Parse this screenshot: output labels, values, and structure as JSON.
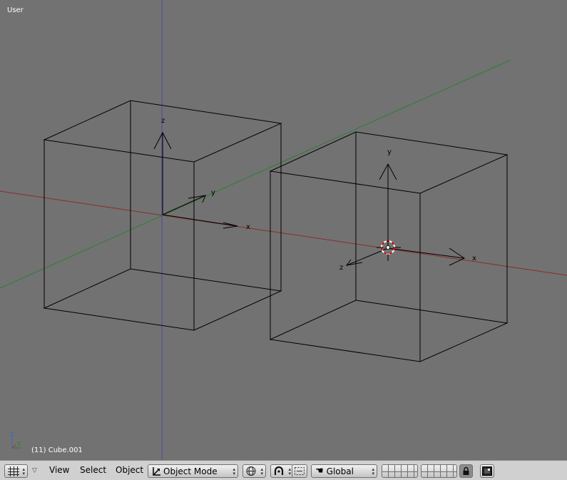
{
  "viewport": {
    "view_label": "User",
    "object_info": "(11) Cube.001",
    "cube_left": {
      "axis_labels": {
        "z": "z",
        "y": "y",
        "x": "x"
      }
    },
    "cube_right": {
      "axis_labels": {
        "y": "y",
        "x": "x",
        "z": "z"
      }
    },
    "mini_axes": {
      "z": "Z",
      "y": "Y"
    },
    "colors": {
      "background": "#727272",
      "x_axis": "#8b2b2b",
      "y_axis": "#2e7d32",
      "z_axis": "#4a4a9a",
      "wire": "#000000",
      "cursor": "#cc0000"
    }
  },
  "header": {
    "editor_type_icon": "grid-icon",
    "menus": {
      "view": "View",
      "select": "Select",
      "object": "Object"
    },
    "mode": "Object Mode",
    "orientation": "Global",
    "colors": {
      "bar": "#d0d0d0"
    }
  }
}
